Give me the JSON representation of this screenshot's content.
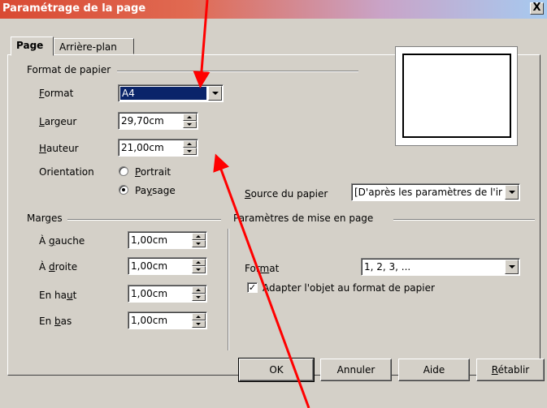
{
  "window": {
    "title": "Paramétrage de la page",
    "close_glyph": "X"
  },
  "tabs": [
    {
      "label": "Page",
      "active": true
    },
    {
      "label": "Arrière-plan",
      "active": false
    }
  ],
  "paper_format": {
    "group_label": "Format de papier",
    "format_label": "Format",
    "format_value": "A4",
    "width_label": "Largeur",
    "width_value": "29,70cm",
    "height_label": "Hauteur",
    "height_value": "21,00cm",
    "orientation_label": "Orientation",
    "portrait_label": "Portrait",
    "landscape_label": "Paysage",
    "selected_orientation": "Paysage",
    "paper_source_label": "Source du papier",
    "paper_source_value": "[D'après les paramètres de l'ir"
  },
  "margins": {
    "group_label": "Marges",
    "left_label": "À gauche",
    "left_value": "1,00cm",
    "right_label": "À droite",
    "right_value": "1,00cm",
    "top_label": "En haut",
    "top_value": "1,00cm",
    "bottom_label": "En bas",
    "bottom_value": "1,00cm"
  },
  "layout_settings": {
    "group_label": "Paramètres de mise en page",
    "format_label": "Format",
    "format_value": "1, 2, 3, ...",
    "fit_object_label": "Adapter l'objet au format de papier",
    "fit_object_checked": true,
    "check_glyph": "✓"
  },
  "buttons": {
    "ok": "OK",
    "cancel": "Annuler",
    "help": "Aide",
    "reset": "Rétablir"
  },
  "colors": {
    "annotation_arrow": "#ff0000",
    "selection": "#0a246a",
    "face": "#d4d0c8"
  }
}
